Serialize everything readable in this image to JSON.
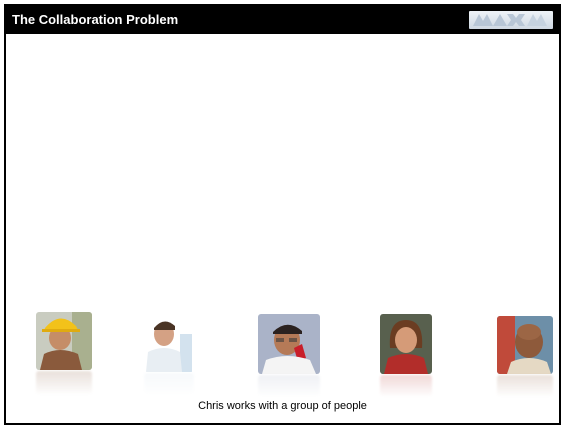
{
  "slide": {
    "title": "The Collaboration Problem",
    "caption": "Chris works with a group of people"
  },
  "logo": {
    "icon": "max-logo"
  },
  "people": [
    {
      "name": "worker-hardhat",
      "icon": "person-photo"
    },
    {
      "name": "man-smiling",
      "icon": "person-photo"
    },
    {
      "name": "man-on-phone",
      "icon": "person-photo"
    },
    {
      "name": "woman-smiling",
      "icon": "person-photo"
    },
    {
      "name": "man-bald",
      "icon": "person-photo"
    }
  ],
  "colors": {
    "title_bar": "#000000",
    "title_text": "#ffffff",
    "background": "#ffffff"
  }
}
